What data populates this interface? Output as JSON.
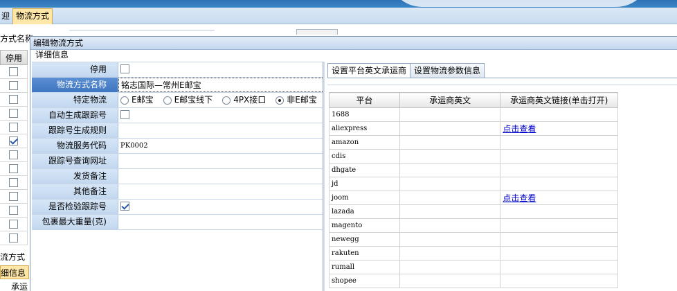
{
  "app": {
    "prev_tab": "迎",
    "active_tab": "物流方式"
  },
  "background": {
    "filter_label": "方式名称",
    "col_header": "停用",
    "row_checks": [
      false,
      false,
      false,
      false,
      false,
      true,
      false,
      false,
      false,
      false,
      false,
      false,
      false
    ],
    "lower_label": "流方式",
    "lower_tab": "细信息",
    "lower_col": "承运"
  },
  "dialog": {
    "title": "编辑物流方式",
    "section": "详细信息",
    "form": {
      "disabled_label": "停用",
      "disabled_checked": false,
      "name_label": "物流方式名称",
      "name_value": "铭志国际—常州E邮宝",
      "special_label": "特定物流",
      "special_options": [
        "E邮宝",
        "E邮宝线下",
        "4PX接口",
        "非E邮宝"
      ],
      "special_selected": 3,
      "auto_tracking_label": "自动生成跟踪号",
      "auto_tracking_checked": false,
      "tracking_rule_label": "跟踪号生成规则",
      "tracking_rule_value": "",
      "service_code_label": "物流服务代码",
      "service_code_value": "PK0002",
      "tracking_url_label": "跟踪号查询网址",
      "tracking_url_value": "",
      "ship_note_label": "发货备注",
      "ship_note_value": "",
      "other_note_label": "其他备注",
      "other_note_value": "",
      "verify_tracking_label": "是否检验跟踪号",
      "verify_tracking_checked": true,
      "max_weight_label": "包裹最大重量(克)",
      "max_weight_value": ""
    },
    "right": {
      "tabs": [
        "设置平台英文承运商",
        "设置物流参数信息"
      ],
      "active_tab": 0,
      "columns": [
        "平台",
        "承运商英文",
        "承运商英文链接(单击打开)"
      ],
      "rows": [
        {
          "platform": "1688",
          "carrier": "",
          "link": ""
        },
        {
          "platform": "aliexpress",
          "carrier": "",
          "link": "点击查看"
        },
        {
          "platform": "amazon",
          "carrier": "",
          "link": ""
        },
        {
          "platform": "cdis",
          "carrier": "",
          "link": ""
        },
        {
          "platform": "dhgate",
          "carrier": "",
          "link": ""
        },
        {
          "platform": "jd",
          "carrier": "",
          "link": ""
        },
        {
          "platform": "joom",
          "carrier": "",
          "link": "点击查看"
        },
        {
          "platform": "lazada",
          "carrier": "",
          "link": ""
        },
        {
          "platform": "magento",
          "carrier": "",
          "link": ""
        },
        {
          "platform": "newegg",
          "carrier": "",
          "link": ""
        },
        {
          "platform": "rakuten",
          "carrier": "",
          "link": ""
        },
        {
          "platform": "rumall",
          "carrier": "",
          "link": ""
        },
        {
          "platform": "shopee",
          "carrier": "",
          "link": ""
        }
      ]
    }
  }
}
